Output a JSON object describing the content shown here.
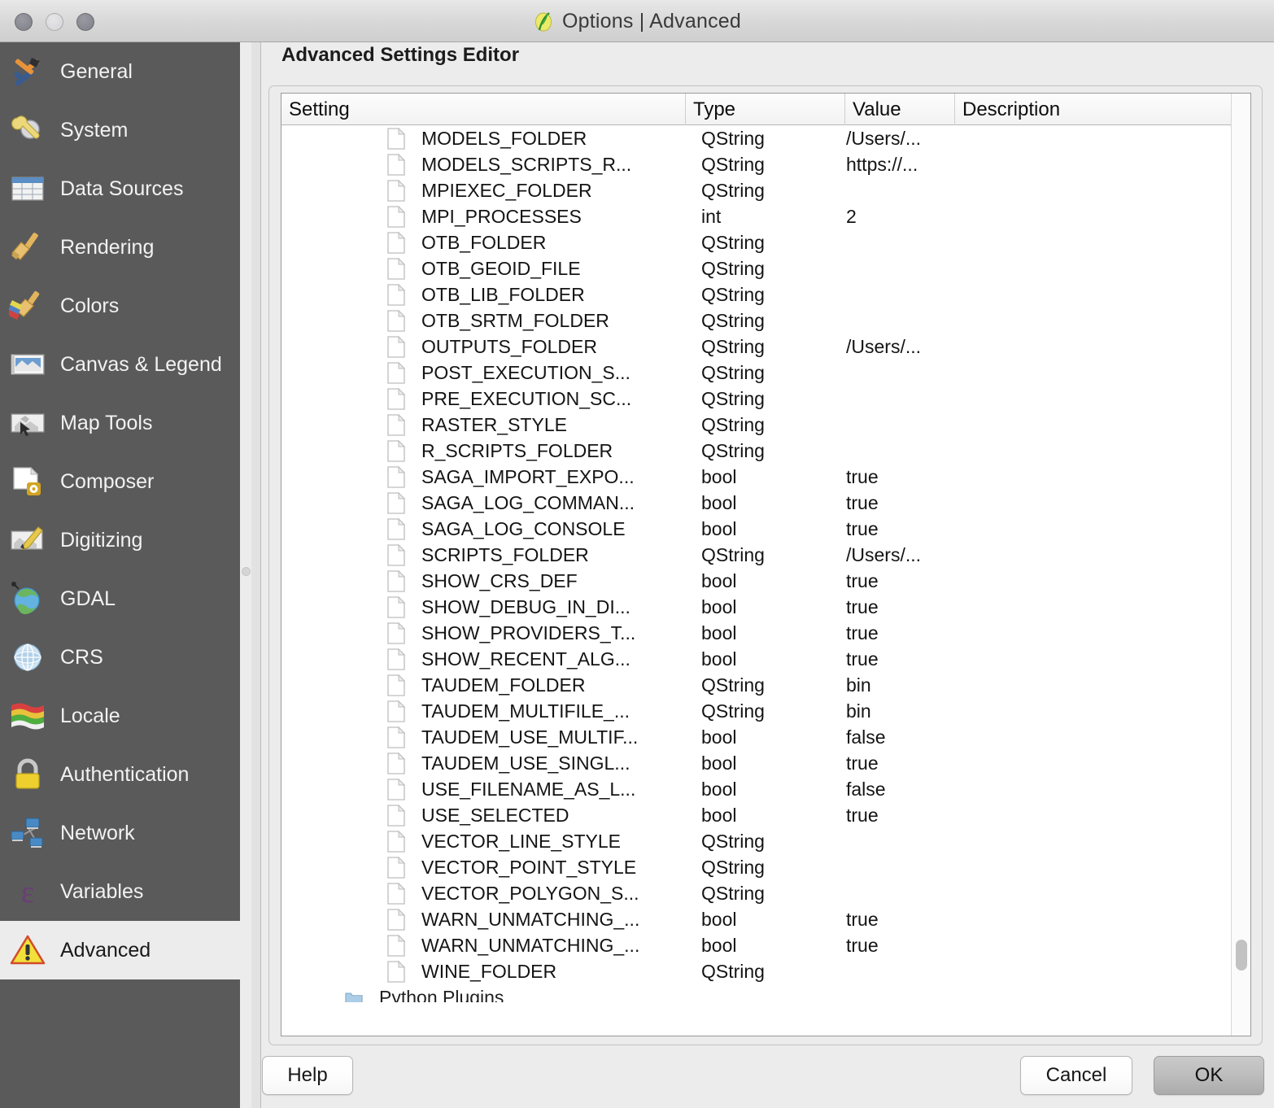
{
  "window": {
    "title": "Options | Advanced",
    "app_icon": "qgis-leaf-icon",
    "traffic_lights": [
      "close",
      "minimize",
      "zoom"
    ]
  },
  "sidebar": {
    "items": [
      {
        "label": "General",
        "icon": "hammer-screwdriver-icon",
        "selected": false
      },
      {
        "label": "System",
        "icon": "wrench-gear-icon",
        "selected": false
      },
      {
        "label": "Data Sources",
        "icon": "table-icon",
        "selected": false
      },
      {
        "label": "Rendering",
        "icon": "paintbrush-icon",
        "selected": false
      },
      {
        "label": "Colors",
        "icon": "color-brush-icon",
        "selected": false
      },
      {
        "label": "Canvas & Legend",
        "icon": "map-canvas-icon",
        "selected": false
      },
      {
        "label": "Map Tools",
        "icon": "map-cursor-icon",
        "selected": false
      },
      {
        "label": "Composer",
        "icon": "page-gear-icon",
        "selected": false
      },
      {
        "label": "Digitizing",
        "icon": "map-pencil-icon",
        "selected": false
      },
      {
        "label": "GDAL",
        "icon": "globe-icon",
        "selected": false
      },
      {
        "label": "CRS",
        "icon": "crs-globe-icon",
        "selected": false
      },
      {
        "label": "Locale",
        "icon": "flags-icon",
        "selected": false
      },
      {
        "label": "Authentication",
        "icon": "lock-icon",
        "selected": false
      },
      {
        "label": "Network",
        "icon": "network-icon",
        "selected": false
      },
      {
        "label": "Variables",
        "icon": "epsilon-icon",
        "selected": false
      },
      {
        "label": "Advanced",
        "icon": "warning-triangle-icon",
        "selected": true
      }
    ]
  },
  "main": {
    "page_title": "Advanced Settings Editor",
    "table": {
      "columns": [
        "Setting",
        "Type",
        "Value",
        "Description"
      ],
      "rows": [
        {
          "setting": "MODELS_FOLDER",
          "type": "QString",
          "value": "/Users/...",
          "description": "",
          "icon": "document-icon"
        },
        {
          "setting": "MODELS_SCRIPTS_R...",
          "type": "QString",
          "value": "https://...",
          "description": "",
          "icon": "document-icon"
        },
        {
          "setting": "MPIEXEC_FOLDER",
          "type": "QString",
          "value": "",
          "description": "",
          "icon": "document-icon"
        },
        {
          "setting": "MPI_PROCESSES",
          "type": "int",
          "value": "2",
          "description": "",
          "icon": "document-icon"
        },
        {
          "setting": "OTB_FOLDER",
          "type": "QString",
          "value": "",
          "description": "",
          "icon": "document-icon"
        },
        {
          "setting": "OTB_GEOID_FILE",
          "type": "QString",
          "value": "",
          "description": "",
          "icon": "document-icon"
        },
        {
          "setting": "OTB_LIB_FOLDER",
          "type": "QString",
          "value": "",
          "description": "",
          "icon": "document-icon"
        },
        {
          "setting": "OTB_SRTM_FOLDER",
          "type": "QString",
          "value": "",
          "description": "",
          "icon": "document-icon"
        },
        {
          "setting": "OUTPUTS_FOLDER",
          "type": "QString",
          "value": "/Users/...",
          "description": "",
          "icon": "document-icon"
        },
        {
          "setting": "POST_EXECUTION_S...",
          "type": "QString",
          "value": "",
          "description": "",
          "icon": "document-icon"
        },
        {
          "setting": "PRE_EXECUTION_SC...",
          "type": "QString",
          "value": "",
          "description": "",
          "icon": "document-icon"
        },
        {
          "setting": "RASTER_STYLE",
          "type": "QString",
          "value": "",
          "description": "",
          "icon": "document-icon"
        },
        {
          "setting": "R_SCRIPTS_FOLDER",
          "type": "QString",
          "value": "",
          "description": "",
          "icon": "document-icon"
        },
        {
          "setting": "SAGA_IMPORT_EXPO...",
          "type": "bool",
          "value": "true",
          "description": "",
          "icon": "document-icon"
        },
        {
          "setting": "SAGA_LOG_COMMAN...",
          "type": "bool",
          "value": "true",
          "description": "",
          "icon": "document-icon"
        },
        {
          "setting": "SAGA_LOG_CONSOLE",
          "type": "bool",
          "value": "true",
          "description": "",
          "icon": "document-icon"
        },
        {
          "setting": "SCRIPTS_FOLDER",
          "type": "QString",
          "value": "/Users/...",
          "description": "",
          "icon": "document-icon"
        },
        {
          "setting": "SHOW_CRS_DEF",
          "type": "bool",
          "value": "true",
          "description": "",
          "icon": "document-icon"
        },
        {
          "setting": "SHOW_DEBUG_IN_DI...",
          "type": "bool",
          "value": "true",
          "description": "",
          "icon": "document-icon"
        },
        {
          "setting": "SHOW_PROVIDERS_T...",
          "type": "bool",
          "value": "true",
          "description": "",
          "icon": "document-icon"
        },
        {
          "setting": "SHOW_RECENT_ALG...",
          "type": "bool",
          "value": "true",
          "description": "",
          "icon": "document-icon"
        },
        {
          "setting": "TAUDEM_FOLDER",
          "type": "QString",
          "value": "bin",
          "description": "",
          "icon": "document-icon"
        },
        {
          "setting": "TAUDEM_MULTIFILE_...",
          "type": "QString",
          "value": "bin",
          "description": "",
          "icon": "document-icon"
        },
        {
          "setting": "TAUDEM_USE_MULTIF...",
          "type": "bool",
          "value": "false",
          "description": "",
          "icon": "document-icon"
        },
        {
          "setting": "TAUDEM_USE_SINGL...",
          "type": "bool",
          "value": "true",
          "description": "",
          "icon": "document-icon"
        },
        {
          "setting": "USE_FILENAME_AS_L...",
          "type": "bool",
          "value": "false",
          "description": "",
          "icon": "document-icon"
        },
        {
          "setting": "USE_SELECTED",
          "type": "bool",
          "value": "true",
          "description": "",
          "icon": "document-icon"
        },
        {
          "setting": "VECTOR_LINE_STYLE",
          "type": "QString",
          "value": "",
          "description": "",
          "icon": "document-icon"
        },
        {
          "setting": "VECTOR_POINT_STYLE",
          "type": "QString",
          "value": "",
          "description": "",
          "icon": "document-icon"
        },
        {
          "setting": "VECTOR_POLYGON_S...",
          "type": "QString",
          "value": "",
          "description": "",
          "icon": "document-icon"
        },
        {
          "setting": "WARN_UNMATCHING_...",
          "type": "bool",
          "value": "true",
          "description": "",
          "icon": "document-icon"
        },
        {
          "setting": "WARN_UNMATCHING_...",
          "type": "bool",
          "value": "true",
          "description": "",
          "icon": "document-icon"
        },
        {
          "setting": "WINE_FOLDER",
          "type": "QString",
          "value": "",
          "description": "",
          "icon": "document-icon"
        }
      ],
      "partial_row": {
        "setting": "Python Plugins",
        "type": "",
        "value": "",
        "description": "",
        "icon": "folder-icon"
      }
    }
  },
  "footer": {
    "help_label": "Help",
    "cancel_label": "Cancel",
    "ok_label": "OK"
  },
  "colors": {
    "sidebar_bg": "#5a5a5a",
    "sidebar_selected_bg": "#ececec",
    "window_bg": "#ececec",
    "table_bg": "#ffffff",
    "text": "#141414"
  }
}
